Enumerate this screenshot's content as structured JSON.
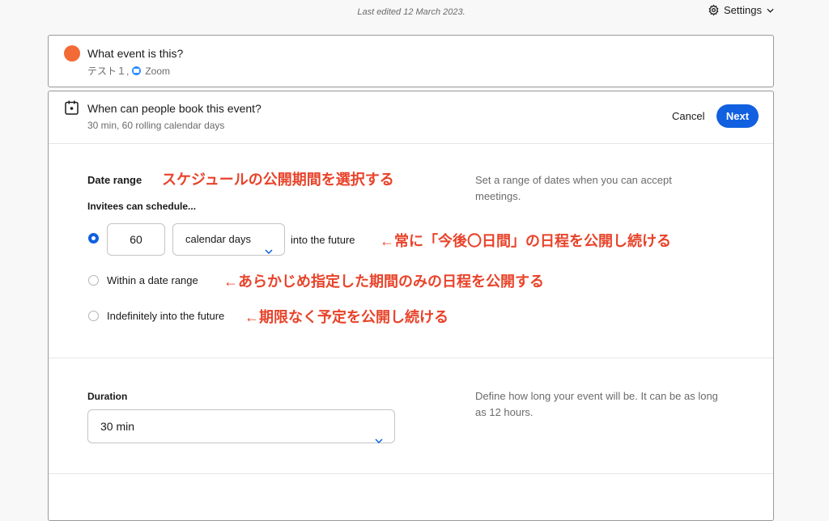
{
  "topbar": {
    "last_edited": "Last edited 12 March 2023.",
    "settings_label": "Settings",
    "settings_icon": "gear-icon"
  },
  "event_card": {
    "title": "What event is this?",
    "subtitle_name": "テスト１,",
    "location": "Zoom",
    "dot_color": "#f26a36"
  },
  "booking_card": {
    "title": "When can people book this event?",
    "subtitle": "30 min, 60 rolling calendar days",
    "cancel_label": "Cancel",
    "next_label": "Next",
    "accent": "#1060e0"
  },
  "date_range": {
    "label": "Date range",
    "annotation": "スケジュールの公開期間を選択する",
    "help": "Set a range of dates when you can accept meetings.",
    "invitees_label": "Invitees can schedule...",
    "options": [
      {
        "selected": true,
        "days_value": "60",
        "unit_value": "calendar days",
        "suffix": "into the future",
        "annotation": "←常に「今後〇日間」の日程を公開し続ける"
      },
      {
        "selected": false,
        "label": "Within a date range",
        "annotation": "←あらかじめ指定した期間のみの日程を公開する"
      },
      {
        "selected": false,
        "label": "Indefinitely into the future",
        "annotation": "←期限なく予定を公開し続ける"
      }
    ]
  },
  "duration": {
    "label": "Duration",
    "value": "30 min",
    "help": "Define how long your event will be. It can be as long as 12 hours."
  }
}
